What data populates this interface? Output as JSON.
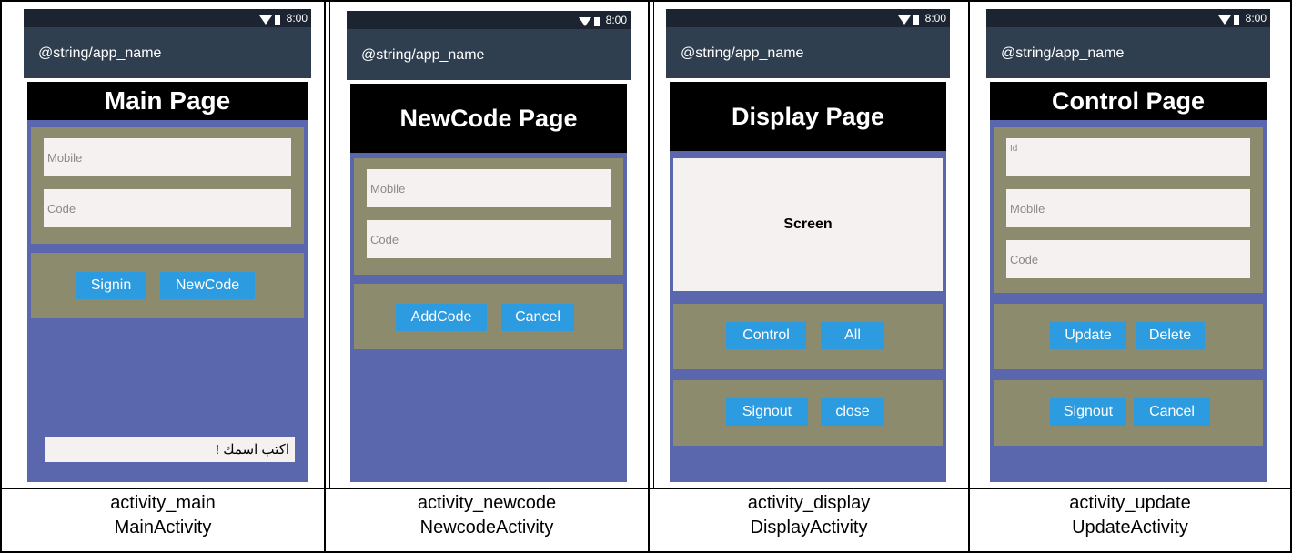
{
  "status_time": "8:00",
  "app_name": "@string/app_name",
  "screens": [
    {
      "header": "Main Page",
      "fields": [
        "Mobile",
        "Code"
      ],
      "buttons": [
        "Signin",
        "NewCode"
      ],
      "name_input": "اكتب اسمك !",
      "caption": [
        "activity_main",
        "MainActivity"
      ]
    },
    {
      "header": "NewCode Page",
      "fields": [
        "Mobile",
        "Code"
      ],
      "buttons": [
        "AddCode",
        "Cancel"
      ],
      "caption": [
        "activity_newcode",
        "NewcodeActivity"
      ]
    },
    {
      "header": "Display Page",
      "screen_text": "Screen",
      "buttons_row1": [
        "Control",
        "All"
      ],
      "buttons_row2": [
        "Signout",
        "close"
      ],
      "caption": [
        "activity_display",
        "DisplayActivity"
      ]
    },
    {
      "header": "Control Page",
      "fields": [
        "Id",
        "Mobile",
        "Code"
      ],
      "buttons_row1": [
        "Update",
        "Delete"
      ],
      "buttons_row2": [
        "Signout",
        "Cancel"
      ],
      "caption": [
        "activity_update",
        "UpdateActivity"
      ]
    }
  ]
}
